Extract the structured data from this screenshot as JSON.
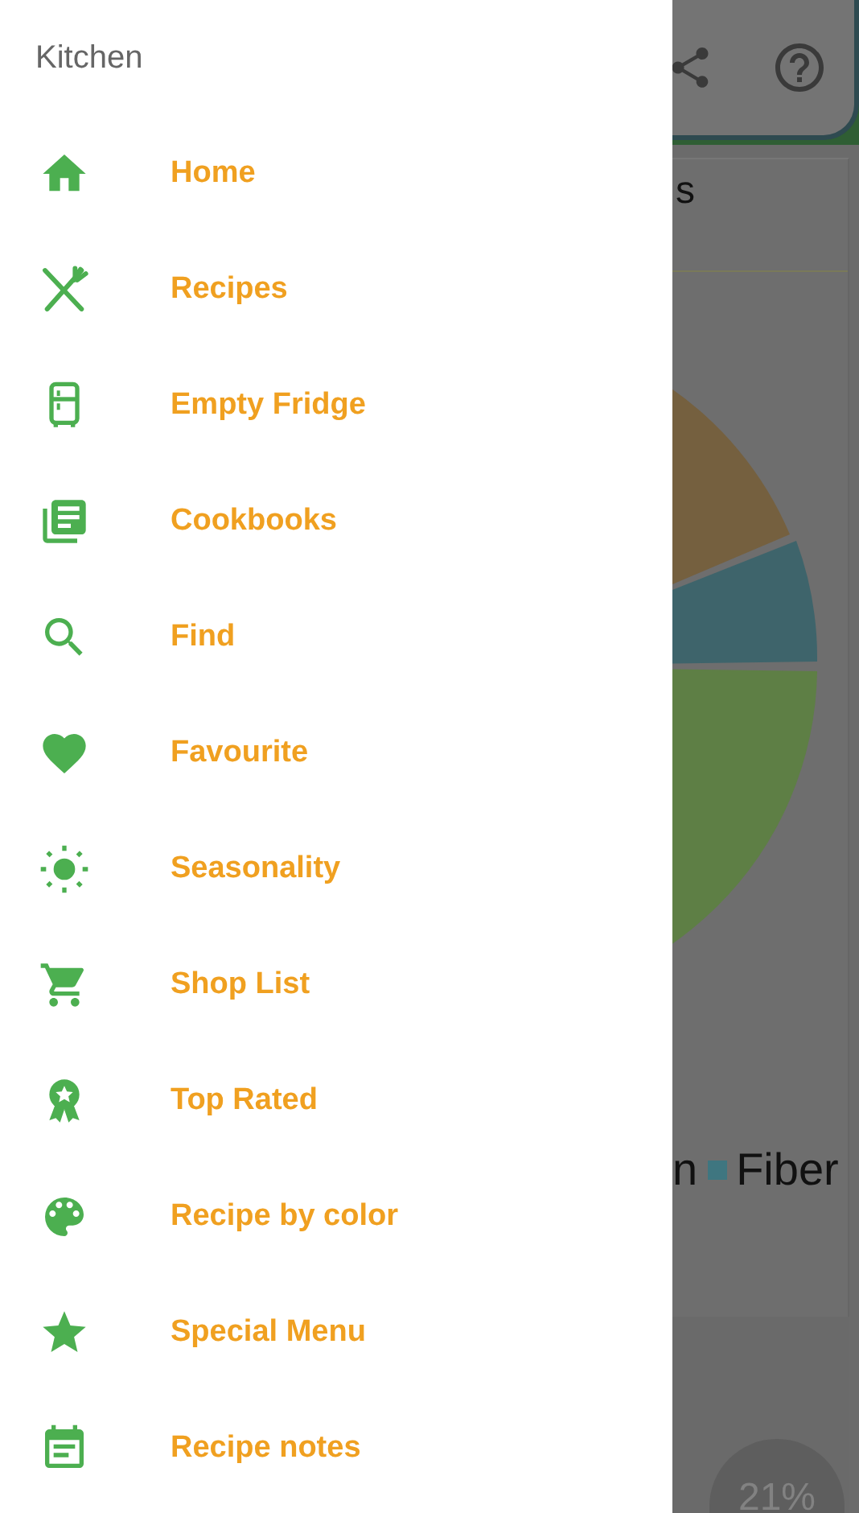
{
  "drawer": {
    "title": "Kitchen",
    "items": [
      {
        "label": "Home"
      },
      {
        "label": "Recipes"
      },
      {
        "label": "Empty Fridge"
      },
      {
        "label": "Cookbooks"
      },
      {
        "label": "Find"
      },
      {
        "label": "Favourite"
      },
      {
        "label": "Seasonality"
      },
      {
        "label": "Shop List"
      },
      {
        "label": "Top Rated"
      },
      {
        "label": "Recipe by color"
      },
      {
        "label": "Special Menu"
      },
      {
        "label": "Recipe notes"
      }
    ]
  },
  "background": {
    "card_title": "s",
    "legend_fragment": "n",
    "legend": [
      {
        "label": "Fiber",
        "color": "#3f7680"
      }
    ],
    "badge": "21%"
  }
}
